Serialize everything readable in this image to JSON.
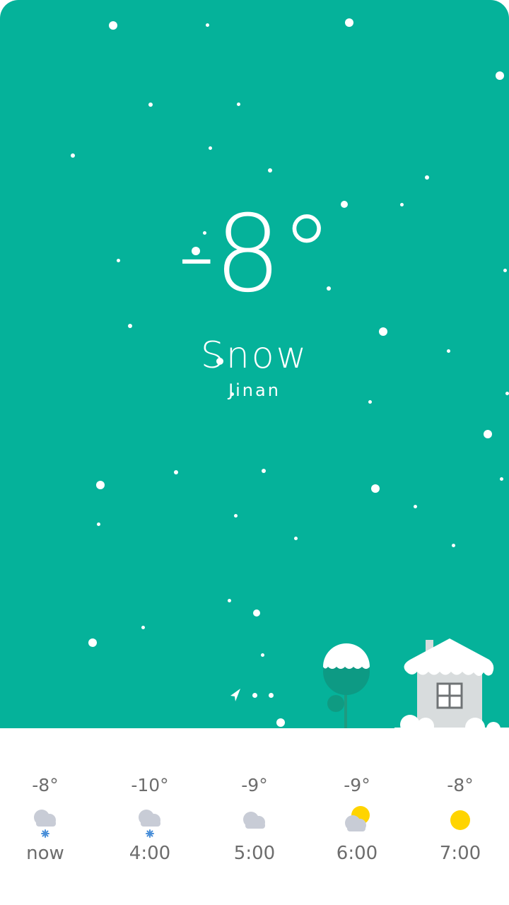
{
  "weather": {
    "temperature": "-8°",
    "condition": "Snow",
    "city": "Jinan"
  },
  "pager": {
    "pages": 3,
    "current": 0,
    "current_icon": "location-arrow-icon"
  },
  "forecast": [
    {
      "temp": "-8°",
      "time": "now",
      "icon": "cloud-snow-icon"
    },
    {
      "temp": "-10°",
      "time": "4:00",
      "icon": "cloud-snow-icon"
    },
    {
      "temp": "-9°",
      "time": "5:00",
      "icon": "cloud-icon"
    },
    {
      "temp": "-9°",
      "time": "6:00",
      "icon": "partly-cloudy-icon"
    },
    {
      "temp": "-8°",
      "time": "7:00",
      "icon": "sun-icon"
    }
  ],
  "colors": {
    "sky": "#05b29a",
    "sun": "#ffd400",
    "cloud": "#c8ccd6",
    "snow_flake": "#4a8fd8"
  }
}
